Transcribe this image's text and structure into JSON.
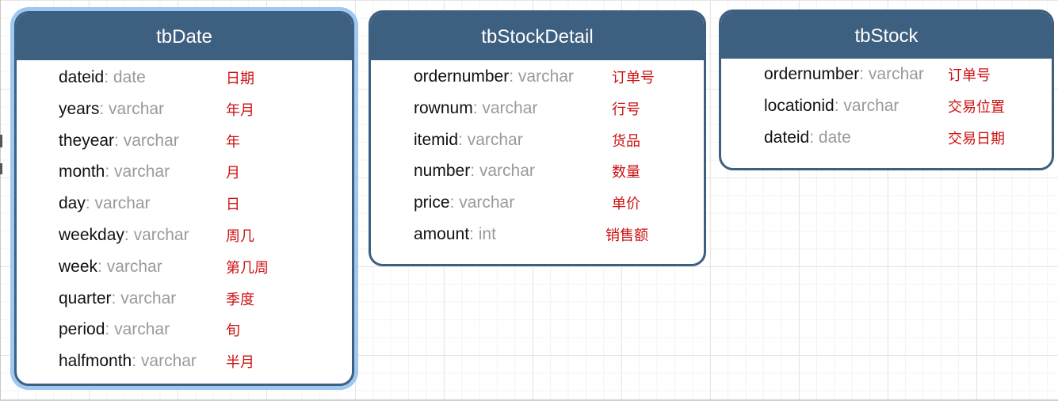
{
  "tables": [
    {
      "name": "tbDate",
      "selected": true,
      "fields": [
        {
          "name": "dateid",
          "sep": ": ",
          "type": "date",
          "desc": "日期"
        },
        {
          "name": "years",
          "sep": ": ",
          "type": "varchar",
          "desc": "年月"
        },
        {
          "name": "theyear",
          "sep": ": ",
          "type": "varchar",
          "desc": "年"
        },
        {
          "name": "month",
          "sep": ": ",
          "type": "varchar",
          "desc": "月"
        },
        {
          "name": "day",
          "sep": ": ",
          "type": "varchar",
          "desc": "日"
        },
        {
          "name": "weekday",
          "sep": ": ",
          "type": "varchar",
          "desc": "周几"
        },
        {
          "name": "week",
          "sep": ": ",
          "type": "varchar",
          "desc": "第几周"
        },
        {
          "name": "quarter",
          "sep": ": ",
          "type": "varchar",
          "desc": "季度"
        },
        {
          "name": "period",
          "sep": ": ",
          "type": "varchar",
          "desc": "旬"
        },
        {
          "name": "halfmonth",
          "sep": ": ",
          "type": "varchar",
          "desc": "半月"
        }
      ]
    },
    {
      "name": "tbStockDetail",
      "selected": false,
      "fields": [
        {
          "name": "ordernumber",
          "sep": ": ",
          "type": "varchar",
          "desc": "订单号"
        },
        {
          "name": "rownum",
          "sep": ": ",
          "type": "varchar",
          "desc": "行号"
        },
        {
          "name": "itemid",
          "sep": ": ",
          "type": "varchar",
          "desc": "货品"
        },
        {
          "name": "number",
          "sep": ": ",
          "type": "varchar",
          "desc": "数量"
        },
        {
          "name": "price",
          "sep": ": ",
          "type": "varchar",
          "desc": "单价"
        },
        {
          "name": "amount",
          "sep": ": ",
          "type": "int",
          "desc": "销售额"
        }
      ]
    },
    {
      "name": "tbStock",
      "selected": false,
      "fields": [
        {
          "name": "ordernumber",
          "sep": ": ",
          "type": "varchar",
          "desc": "订单号"
        },
        {
          "name": "locationid",
          "sep": ": ",
          "type": "varchar",
          "desc": "交易位置"
        },
        {
          "name": "dateid",
          "sep": ": ",
          "type": "date",
          "desc": "交易日期"
        }
      ]
    }
  ],
  "colors": {
    "header": "#3d5f80",
    "selection": "#9cc8f2",
    "field_name": "#111111",
    "field_type": "#9a9a9a",
    "description": "#cc1111"
  }
}
